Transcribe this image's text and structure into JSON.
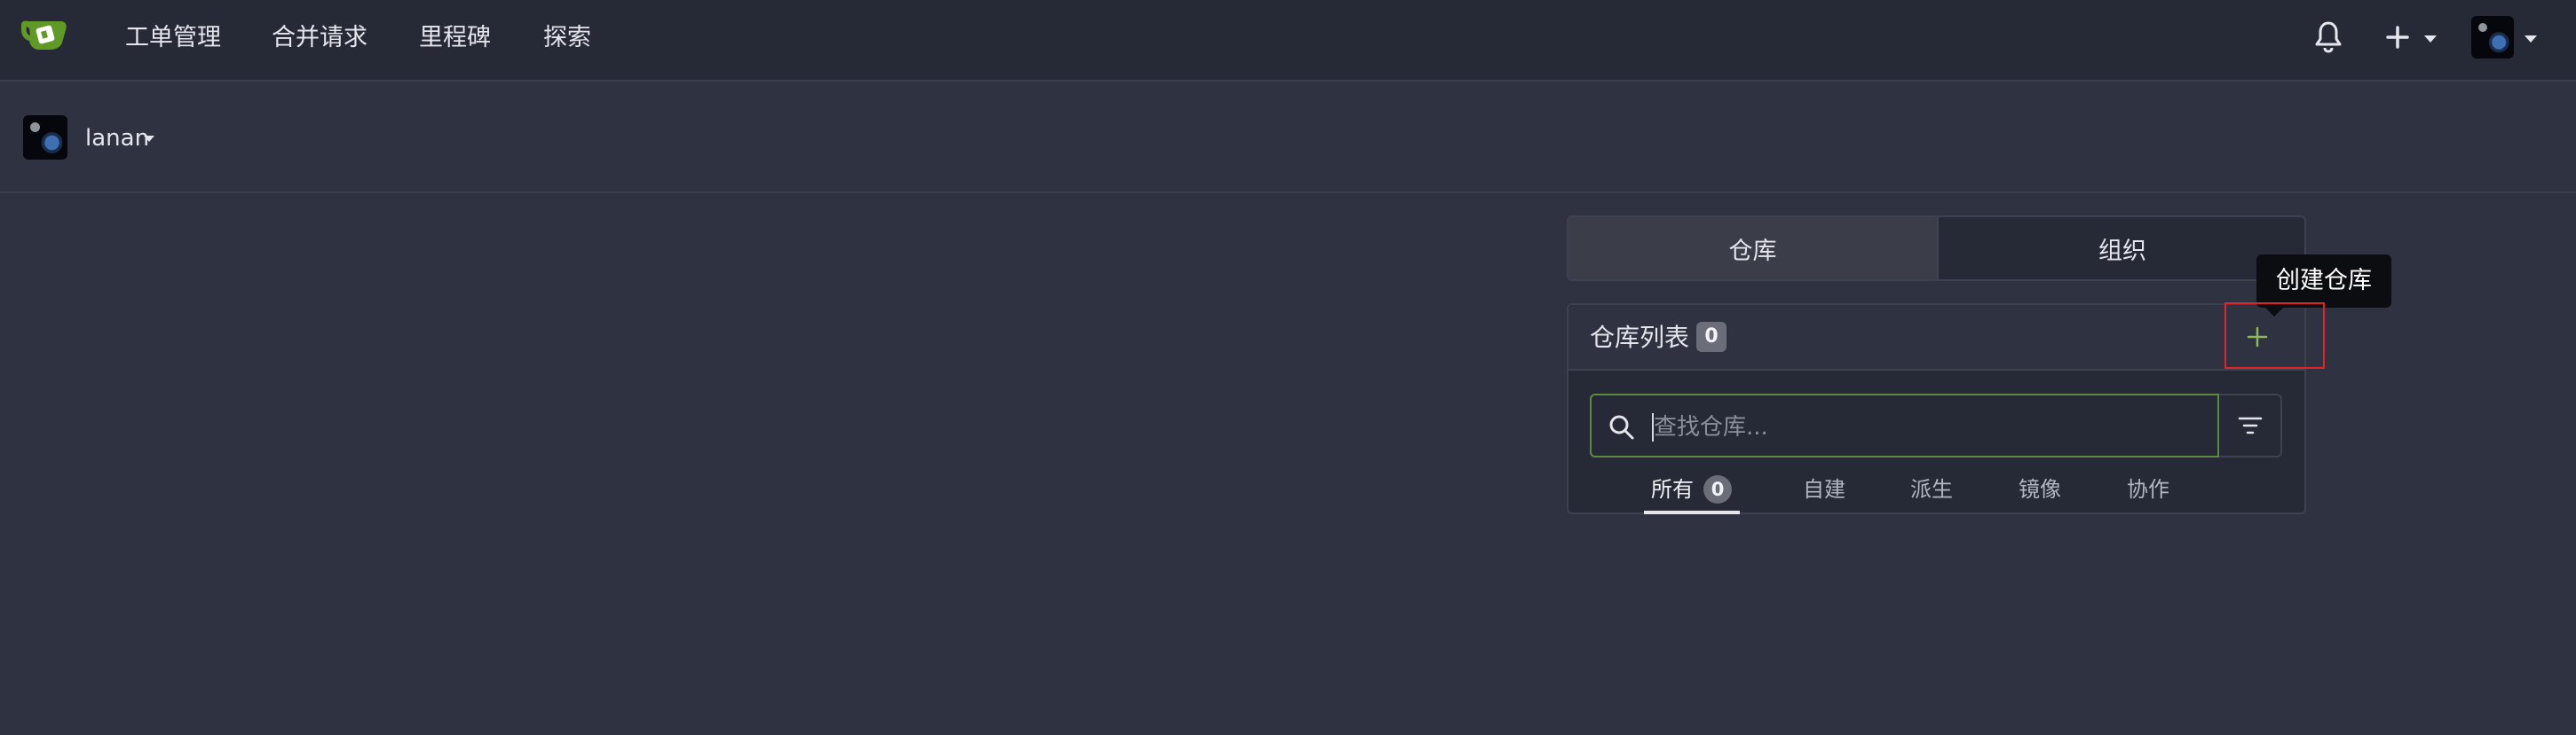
{
  "nav": {
    "items": [
      "工单管理",
      "合并请求",
      "里程碑",
      "探索"
    ]
  },
  "context": {
    "username": "lanan"
  },
  "tabs": {
    "repos": "仓库",
    "orgs": "组织"
  },
  "repo_list": {
    "title": "仓库列表",
    "count": "0",
    "create_tooltip": "创建仓库",
    "search_placeholder": "查找仓库...",
    "filters": [
      {
        "label": "所有",
        "count": "0"
      },
      {
        "label": "自建"
      },
      {
        "label": "派生"
      },
      {
        "label": "镜像"
      },
      {
        "label": "协作"
      }
    ]
  },
  "colors": {
    "brand_green": "#609926",
    "highlight_red": "#e0242b",
    "background": "#2f3240",
    "navbar": "#262936"
  },
  "icons": [
    "gitea-logo-icon",
    "bell-icon",
    "plus-icon",
    "search-icon",
    "filter-icon",
    "chevron-down-icon"
  ]
}
